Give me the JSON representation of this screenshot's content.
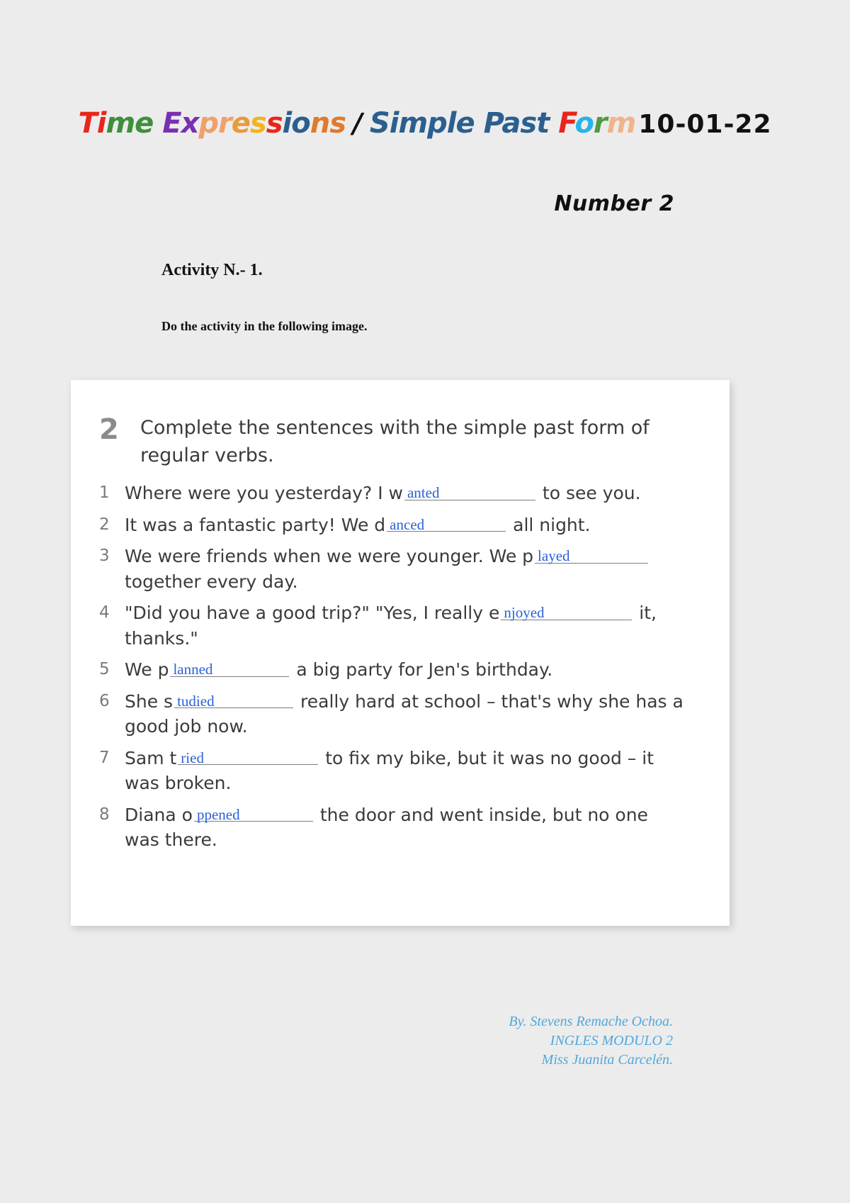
{
  "title": {
    "parts": [
      {
        "text": "T",
        "color": "#e8261c"
      },
      {
        "text": "i",
        "color": "#e8261c"
      },
      {
        "text": "m",
        "color": "#3f8f3a"
      },
      {
        "text": "e",
        "color": "#3f8f3a"
      },
      {
        "text": " ",
        "color": "#111111"
      },
      {
        "text": "E",
        "color": "#7a2fb0"
      },
      {
        "text": "x",
        "color": "#7a2fb0"
      },
      {
        "text": "p",
        "color": "#f0a06a"
      },
      {
        "text": "r",
        "color": "#f0a06a"
      },
      {
        "text": "e",
        "color": "#e89a3c"
      },
      {
        "text": "s",
        "color": "#f2b31d"
      },
      {
        "text": "s",
        "color": "#e8261c"
      },
      {
        "text": "i",
        "color": "#2b5f8f"
      },
      {
        "text": "o",
        "color": "#2b5f8f"
      },
      {
        "text": "n",
        "color": "#e07a2c"
      },
      {
        "text": "s",
        "color": "#e07a2c"
      }
    ],
    "separator": "/",
    "parts2": [
      {
        "text": "S",
        "color": "#2b5f8f"
      },
      {
        "text": "i",
        "color": "#2b5f8f"
      },
      {
        "text": "m",
        "color": "#2b5f8f"
      },
      {
        "text": "p",
        "color": "#2b5f8f"
      },
      {
        "text": "l",
        "color": "#2b5f8f"
      },
      {
        "text": "e",
        "color": "#2b5f8f"
      },
      {
        "text": " ",
        "color": "#2b5f8f"
      },
      {
        "text": "P",
        "color": "#2b5f8f"
      },
      {
        "text": "a",
        "color": "#2b5f8f"
      },
      {
        "text": "s",
        "color": "#2b5f8f"
      },
      {
        "text": "t",
        "color": "#2b5f8f"
      },
      {
        "text": " ",
        "color": "#111111"
      },
      {
        "text": "F",
        "color": "#e8261c"
      },
      {
        "text": "o",
        "color": "#2bb2e8"
      },
      {
        "text": "r",
        "color": "#4f9b3f"
      },
      {
        "text": "m",
        "color": "#f0b48a"
      }
    ],
    "date": "10-01-22",
    "full_text": "Time Expressions / Simple Past Form 10-01-22"
  },
  "number_label": "Number 2",
  "headings": {
    "activity": "Activity N.- 1.",
    "instruction": "Do the activity in the following image."
  },
  "worksheet": {
    "exercise_number": "2",
    "prompt": "Complete the sentences with the simple past form of regular verbs.",
    "items": [
      {
        "number": "1",
        "before": "Where were you yesterday? I w",
        "answer": "anted",
        "after": "to see you.",
        "width": "w-lg"
      },
      {
        "number": "2",
        "before": "It was a fantastic party! We d",
        "answer": "anced",
        "after": "all night.",
        "width": "w-md"
      },
      {
        "number": "3",
        "before": "We were friends when we were younger. We p",
        "answer": "layed",
        "after": "together every day.",
        "width": "w-sm"
      },
      {
        "number": "4",
        "before": "\"Did you have a good trip?\" \"Yes, I really e",
        "answer": "njoyed",
        "after": "it, thanks.\"",
        "width": "w-lg"
      },
      {
        "number": "5",
        "before": "We p",
        "answer": "lanned",
        "after": "a big party for Jen's birthday.",
        "width": "w-md"
      },
      {
        "number": "6",
        "before": "She s",
        "answer": "tudied",
        "after": "really hard at school – that's why she has a good job now.",
        "width": "w-md"
      },
      {
        "number": "7",
        "before": "Sam t",
        "answer": "ried",
        "after": "to fix my bike, but it was no good – it was broken.",
        "width": "w-xl"
      },
      {
        "number": "8",
        "before": "Diana o",
        "answer": "ppened",
        "after": "the door and went inside, but no one was there.",
        "width": "w-md"
      }
    ]
  },
  "footer": {
    "line1": "By. Stevens Remache Ochoa.",
    "line2": "INGLES MODULO 2",
    "line3": "Miss Juanita Carcelén."
  },
  "colors": {
    "page_background": "#ececec",
    "card_background": "#ffffff",
    "answer_blue": "#2a62d8",
    "footer_blue": "#4fa8dc",
    "printed_text": "#3b3b3b"
  }
}
